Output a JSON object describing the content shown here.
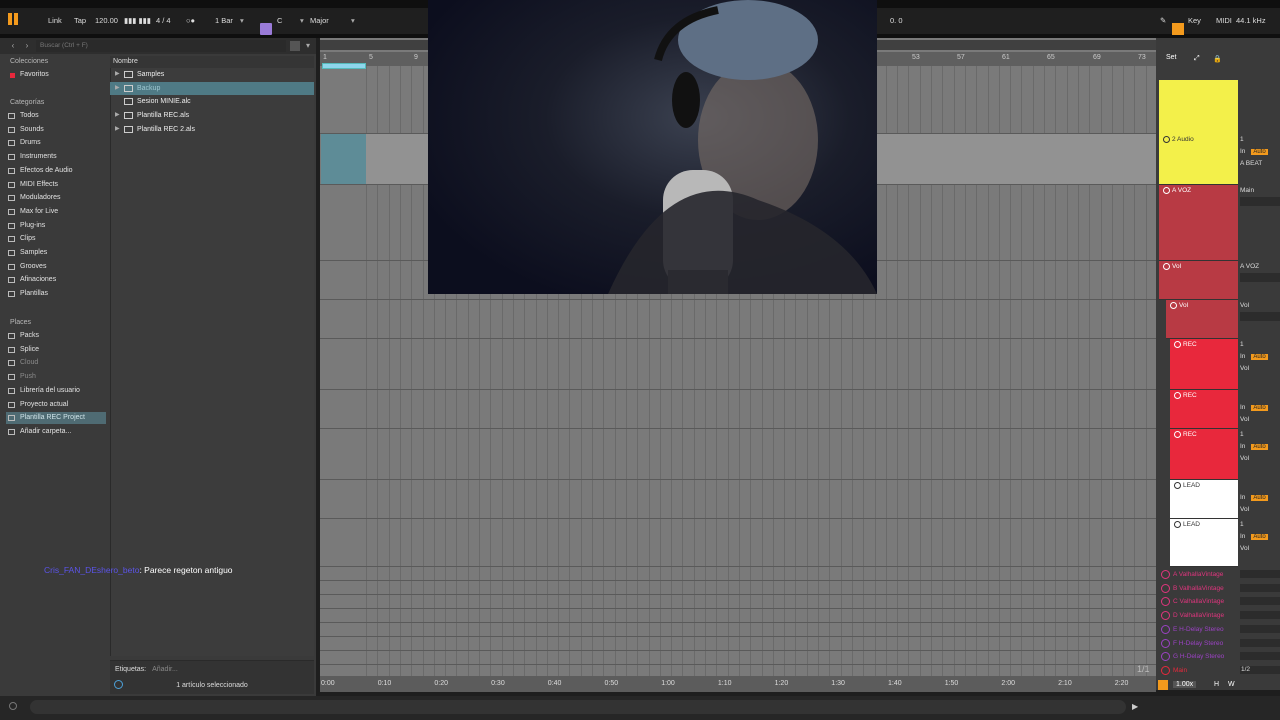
{
  "transport": {
    "link": "Link",
    "tap": "Tap",
    "tempo": "120.00",
    "signature": "4 / 4",
    "metro": "○●",
    "quant": "1 Bar",
    "key": "C",
    "scale": "Major",
    "position": "0. 0",
    "key_label": "Key",
    "midi_label": "MIDI",
    "sample_rate": "44.1 kHz"
  },
  "browser": {
    "search_placeholder": "Buscar (Ctrl + F)",
    "collections_title": "Colecciones",
    "favorites": "Favoritos",
    "categories_title": "Categorías",
    "categories": [
      "Todos",
      "Sounds",
      "Drums",
      "Instruments",
      "Efectos de Audio",
      "MIDI Effects",
      "Moduladores",
      "Max for Live",
      "Plug-ins",
      "Clips",
      "Samples",
      "Grooves",
      "Afinaciones",
      "Plantillas"
    ],
    "places_title": "Places",
    "places": [
      "Packs",
      "Splice",
      "Cloud",
      "Push",
      "Librería del usuario",
      "Proyecto actual",
      "Plantilla REC Project",
      "Añadir carpeta..."
    ],
    "column_name": "Nombre",
    "files": [
      "Samples",
      "Backup",
      "Sesion MINIE.alc",
      "Plantilla REC.als",
      "Plantilla REC 2.als"
    ],
    "tags_label": "Etiquetas:",
    "tags_placeholder": "Añadir...",
    "status": "1 artículo seleccionado"
  },
  "chat": {
    "user": "Cris_FAN_DEshero_beto",
    "message": ": Parece regeton antiguo"
  },
  "arrangement": {
    "bars": [
      "1",
      "5",
      "9",
      "53",
      "57",
      "61",
      "65",
      "69",
      "73"
    ],
    "set_label": "Set",
    "times": [
      "0:00",
      "0:10",
      "0:20",
      "0:30",
      "0:40",
      "0:50",
      "1:00",
      "1:10",
      "1:20",
      "1:30",
      "1:40",
      "1:50",
      "2:00",
      "2:10",
      "2:20"
    ],
    "page": "1/1"
  },
  "tracks": [
    {
      "name": "2 Audio",
      "io1": "1",
      "io3": "A BEAT",
      "color": "#f3f04a"
    },
    {
      "name": "A VOZ",
      "io1": "Main",
      "color": "#b83a44"
    },
    {
      "name": "Vol",
      "io1": "A VOZ",
      "color": "#b83a44"
    },
    {
      "name": "Vol",
      "io1": "Vol",
      "color": "#b83a44"
    },
    {
      "name": "REC",
      "io1": "1",
      "io3": "Vol",
      "color": "#e8283c"
    },
    {
      "name": "REC",
      "io3": "Vol",
      "color": "#e8283c"
    },
    {
      "name": "REC",
      "io1": "1",
      "io3": "Vol",
      "color": "#e8283c"
    },
    {
      "name": "LEAD",
      "io3": "Vol",
      "color": "#ffffff"
    },
    {
      "name": "LEAD",
      "io1": "1",
      "io3": "Vol",
      "color": "#ffffff"
    }
  ],
  "returns": [
    {
      "name": "A ValhallaVintage",
      "color": "#e0357e"
    },
    {
      "name": "B ValhallaVintage",
      "color": "#e0357e"
    },
    {
      "name": "C ValhallaVintage",
      "color": "#e0357e"
    },
    {
      "name": "D ValhallaVintage",
      "color": "#e0357e"
    },
    {
      "name": "E H-Delay Stereo",
      "color": "#9b42c4"
    },
    {
      "name": "F H-Delay Stereo",
      "color": "#9b42c4"
    },
    {
      "name": "G H-Delay Stereo",
      "color": "#9b42c4"
    },
    {
      "name": "Main",
      "color": "#e8283c"
    }
  ],
  "io_labels": {
    "in": "In",
    "auto": "Auto"
  },
  "main_io": "1/2",
  "zoom": "1.00x",
  "h": "H",
  "w": "W"
}
